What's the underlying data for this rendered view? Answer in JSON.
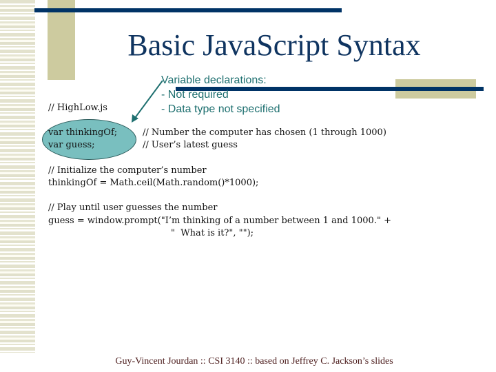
{
  "slide": {
    "title": "Basic JavaScript Syntax",
    "annotation": {
      "heading": "Variable declarations:",
      "bullets": [
        "- Not required",
        "- Data type not specified"
      ]
    },
    "code": {
      "filename_comment": "// HighLow.js",
      "decl_lines": [
        "var thinkingOf;",
        "var guess;"
      ],
      "decl_comments": [
        "// Number the computer has chosen (1 through 1000)",
        "// User’s latest guess"
      ],
      "init_comment": "// Initialize the computer’s number",
      "init_line": "thinkingOf = Math.ceil(Math.random()*1000);",
      "play_comment": "// Play until user guesses the number",
      "prompt_line1": "guess = window.prompt(\"I’m thinking of a number between 1 and 1000.\" +",
      "prompt_line2": "\"  What is it?\", \"\");"
    },
    "footer": "Guy-Vincent Jourdan :: CSI 3140 :: based on Jeffrey C. Jackson’s slides"
  },
  "colors": {
    "navy": "#003366",
    "tan": "#cdcb9f",
    "title": "#0f3460",
    "annotation": "#1d6f6f",
    "ellipse_fill": "#79bfbf",
    "footer": "#4a1a1a"
  }
}
